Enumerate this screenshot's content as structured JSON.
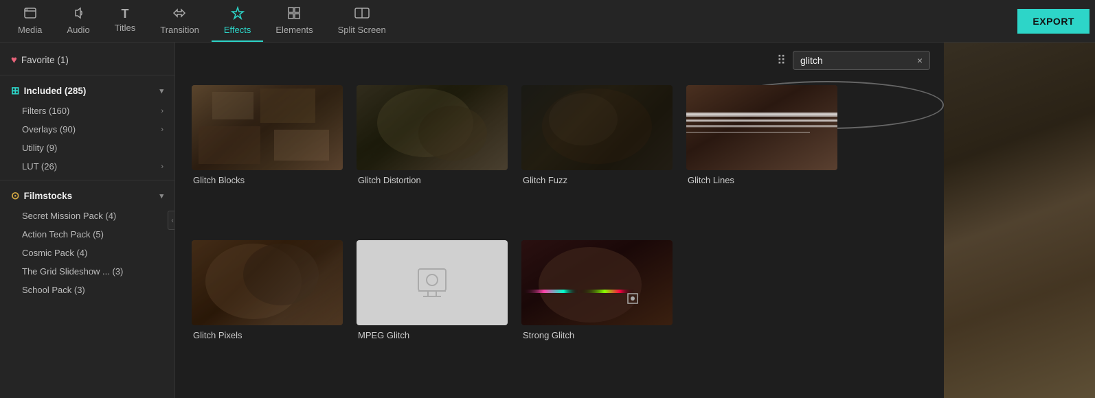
{
  "nav": {
    "items": [
      {
        "id": "media",
        "label": "Media",
        "icon": "📁",
        "active": false
      },
      {
        "id": "audio",
        "label": "Audio",
        "icon": "♪",
        "active": false
      },
      {
        "id": "titles",
        "label": "Titles",
        "icon": "T",
        "active": false
      },
      {
        "id": "transition",
        "label": "Transition",
        "icon": "⇄",
        "active": false
      },
      {
        "id": "effects",
        "label": "Effects",
        "icon": "✦",
        "active": true
      },
      {
        "id": "elements",
        "label": "Elements",
        "icon": "◈",
        "active": false
      },
      {
        "id": "split-screen",
        "label": "Split Screen",
        "icon": "⊞",
        "active": false
      }
    ],
    "export_label": "EXPORT"
  },
  "sidebar": {
    "favorite_label": "Favorite (1)",
    "sections": [
      {
        "id": "included",
        "label": "Included (285)",
        "icon": "grid",
        "expanded": true,
        "children": [
          {
            "id": "filters",
            "label": "Filters (160)",
            "has_arrow": true
          },
          {
            "id": "overlays",
            "label": "Overlays (90)",
            "has_arrow": true
          },
          {
            "id": "utility",
            "label": "Utility (9)",
            "has_arrow": false
          },
          {
            "id": "lut",
            "label": "LUT (26)",
            "has_arrow": true
          }
        ]
      },
      {
        "id": "filmstocks",
        "label": "Filmstocks",
        "icon": "circle",
        "expanded": true,
        "children": [
          {
            "id": "secret-mission",
            "label": "Secret Mission Pack (4)",
            "has_arrow": false
          },
          {
            "id": "action-tech",
            "label": "Action Tech Pack (5)",
            "has_arrow": false
          },
          {
            "id": "cosmic",
            "label": "Cosmic Pack (4)",
            "has_arrow": false
          },
          {
            "id": "grid-slideshow",
            "label": "The Grid Slideshow ... (3)",
            "has_arrow": false
          },
          {
            "id": "school",
            "label": "School Pack (3)",
            "has_arrow": false
          }
        ]
      }
    ]
  },
  "search": {
    "value": "glitch",
    "placeholder": "Search",
    "clear_label": "×"
  },
  "effects": [
    {
      "id": "glitch-blocks",
      "name": "Glitch Blocks",
      "thumb_type": "glitch-blocks"
    },
    {
      "id": "glitch-distortion",
      "name": "Glitch Distortion",
      "thumb_type": "glitch-distortion"
    },
    {
      "id": "glitch-fuzz",
      "name": "Glitch Fuzz",
      "thumb_type": "glitch-fuzz"
    },
    {
      "id": "glitch-lines",
      "name": "Glitch Lines",
      "thumb_type": "glitch-lines"
    },
    {
      "id": "glitch-pixels",
      "name": "Glitch Pixels",
      "thumb_type": "glitch-pixels"
    },
    {
      "id": "mpeg-glitch",
      "name": "MPEG Glitch",
      "thumb_type": "placeholder"
    },
    {
      "id": "strong-glitch",
      "name": "Strong Glitch",
      "thumb_type": "strong-glitch"
    }
  ]
}
